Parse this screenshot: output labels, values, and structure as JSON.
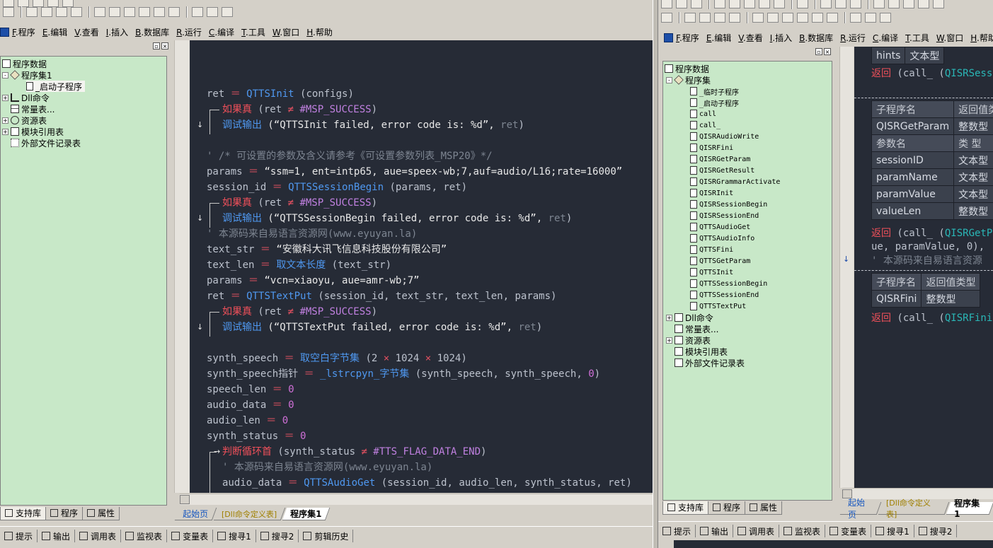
{
  "menu": {
    "items": [
      {
        "key": "F",
        "label": ".程序"
      },
      {
        "key": "E",
        "label": ".编辑"
      },
      {
        "key": "V",
        "label": ".查看"
      },
      {
        "key": "I",
        "label": ".插入"
      },
      {
        "key": "B",
        "label": ".数据库"
      },
      {
        "key": "R",
        "label": ".运行"
      },
      {
        "key": "C",
        "label": ".编译"
      },
      {
        "key": "T",
        "label": ".工具"
      },
      {
        "key": "W",
        "label": ".窗口"
      },
      {
        "key": "H",
        "label": ".帮助"
      }
    ]
  },
  "left_tree": {
    "root": "程序数据",
    "items": [
      {
        "label": "程序集1",
        "level": 1,
        "expander": "-",
        "icon": "package"
      },
      {
        "label": "_启动子程序",
        "level": 2,
        "expander": "",
        "icon": "subroutine",
        "selected": true
      },
      {
        "label": "Dll命令",
        "level": 1,
        "expander": "+",
        "icon": "dll"
      },
      {
        "label": "常量表...",
        "level": 1,
        "expander": "",
        "icon": "table"
      },
      {
        "label": "资源表",
        "level": 1,
        "expander": "+",
        "icon": "resource"
      },
      {
        "label": "模块引用表",
        "level": 1,
        "expander": "+",
        "icon": "module"
      },
      {
        "label": "外部文件记录表",
        "level": 1,
        "expander": "",
        "icon": "document"
      }
    ]
  },
  "right_tree": {
    "root": "程序数据",
    "group": "程序集",
    "subs": [
      "_临时子程序",
      "_启动子程序",
      "call",
      "call_",
      "QISRAudioWrite",
      "QISRFini",
      "QISRGetParam",
      "QISRGetResult",
      "QISRGrammarActivate",
      "QISRInit",
      "QISRSessionBegin",
      "QISRSessionEnd",
      "QTTSAudioGet",
      "QTTSAudioInfo",
      "QTTSFini",
      "QTTSGetParam",
      "QTTSInit",
      "QTTSSessionBegin",
      "QTTSSessionEnd",
      "QTTSTextPut"
    ],
    "tail": [
      {
        "label": "Dll命令",
        "expander": "+"
      },
      {
        "label": "常量表...",
        "expander": ""
      },
      {
        "label": "资源表",
        "expander": "+"
      },
      {
        "label": "模块引用表",
        "expander": ""
      },
      {
        "label": "外部文件记录表",
        "expander": ""
      }
    ]
  },
  "bottom_tabs": [
    "支持库",
    "程序",
    "属性"
  ],
  "doc_tabs": [
    "起始页",
    "[Dll命令定义表]",
    "程序集1"
  ],
  "status_items": [
    "提示",
    "输出",
    "调用表",
    "监视表",
    "变量表",
    "搜寻1",
    "搜寻2",
    "剪辑历史"
  ],
  "status_items_right": [
    "提示",
    "输出",
    "调用表",
    "监视表",
    "变量表",
    "搜寻1",
    "搜寻2"
  ],
  "code": {
    "l1a": "ret",
    "l1b": "QTTSInit",
    "l1c": " (configs)",
    "if_kw": "如果真",
    "l2a": " (ret ",
    "neq": "≠",
    "success": " #MSP_SUCCESS",
    "close": ")",
    "debug_kw": "调试输出",
    "l3a": " (“QTTSInit failed, error code is: %d”, ",
    "ret": "ret",
    "c1": "' /* 可设置的参数及含义请参考《可设置参数列表_MSP20》*/",
    "l5a": "params",
    "l5b": "“ssm=1, ent=intp65, aue=speex-wb;7,auf=audio/L16;rate=16000”",
    "l6a": "session_id",
    "l6b": "QTTSSessionBegin",
    "l6c": " (params, ret)",
    "l8a": " (“QTTSSessionBegin failed, error code is: %d”, ",
    "c2": "' 本源码来自易语言资源网(www.eyuyan.la)",
    "l10a": "text_str",
    "l10b": "“安徽科大讯飞信息科技股份有限公司”",
    "l11a": "text_len",
    "l11b": "取文本长度",
    "l11c": " (text_str)",
    "l12a": "params",
    "l12b": "“vcn=xiaoyu, aue=amr-wb;7”",
    "l13a": "ret",
    "l13b": "QTTSTextPut",
    "l13c": " (session_id, text_str, text_len, params)",
    "l15a": " (“QTTSTextPut failed, error code is: %d”, ",
    "l16a": "synth_speech",
    "l16b": "取空白字节集",
    "l16c": " (2 ",
    "l16d": "×",
    "l16e": " 1024 ",
    "l16f": " 1024)",
    "l17a": "synth_speech指针",
    "l17b": "_lstrcpyn_字节集",
    "l17c": " (synth_speech, synth_speech, ",
    "zero": "0",
    "l18a": "speech_len",
    "l19a": "audio_data",
    "l20a": "audio_len",
    "l21a": "synth_status",
    "loop_kw": "判断循环首",
    "l22a": " (synth_status ",
    "l22b": " #TTS_FLAG_DATA_END",
    "l24a": "audio_data",
    "l24b": "QTTSAudioGet",
    "l24c": " (session_id, audio_len, synth_status, ret)",
    "eq": "＝"
  },
  "right_code": {
    "hints": "hints",
    "hints_type": "文本型",
    "ret_kw": "返回",
    "ret1": " (call_ (",
    "ret1b": "QISRSessi",
    "t1": {
      "h1": "子程序名",
      "h2": "返回值类",
      "name": "QISRGetParam",
      "type": "整数型"
    },
    "t2": {
      "h1": "参数名",
      "h2": "类 型",
      "rows": [
        [
          "sessionID",
          "文本型"
        ],
        [
          "paramName",
          "文本型"
        ],
        [
          "paramValue",
          "文本型"
        ],
        [
          "valueLen",
          "整数型"
        ]
      ]
    },
    "ret2a": " (call_ (",
    "ret2b": "QISRGetPa",
    "ret2c": "ue, paramValue, 0), ",
    "cmt": "' 本源码来自易语言资源",
    "t3": {
      "h1": "子程序名",
      "h2": "返回值类型",
      "name": "QISRFini",
      "type": "整数型"
    },
    "ret3a": " (call_ (",
    "ret3b": "QISRFini"
  }
}
